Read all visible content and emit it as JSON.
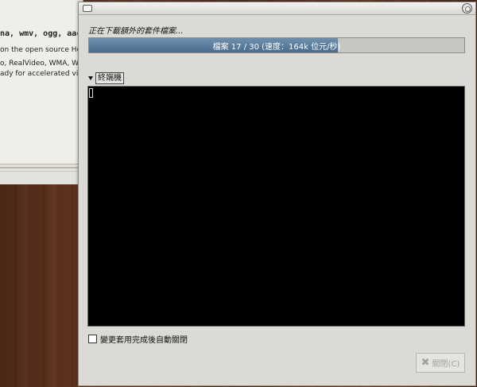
{
  "background_window": {
    "line1": "na, wmv, ogg, aac, a",
    "line2": "on the open source He",
    "line3": "o, RealVideo, WMA, WM",
    "line4": "ady for accelerated vide"
  },
  "dialog": {
    "status_text": "正在下載額外的套件檔案...",
    "progress": {
      "label": "檔案 17 / 30 (速度：164k 位元/秒)",
      "fraction": 0.663
    },
    "expander_label": "終端機",
    "checkbox_label": "變更套用完成後自動關閉",
    "checkbox_checked": false,
    "close_button_label": "關閉(C)",
    "close_button_icon": "close-x-icon"
  },
  "colors": {
    "progress_fill": "#4a6b8c",
    "terminal_bg": "#000000",
    "dialog_bg": "#dcdad5"
  }
}
